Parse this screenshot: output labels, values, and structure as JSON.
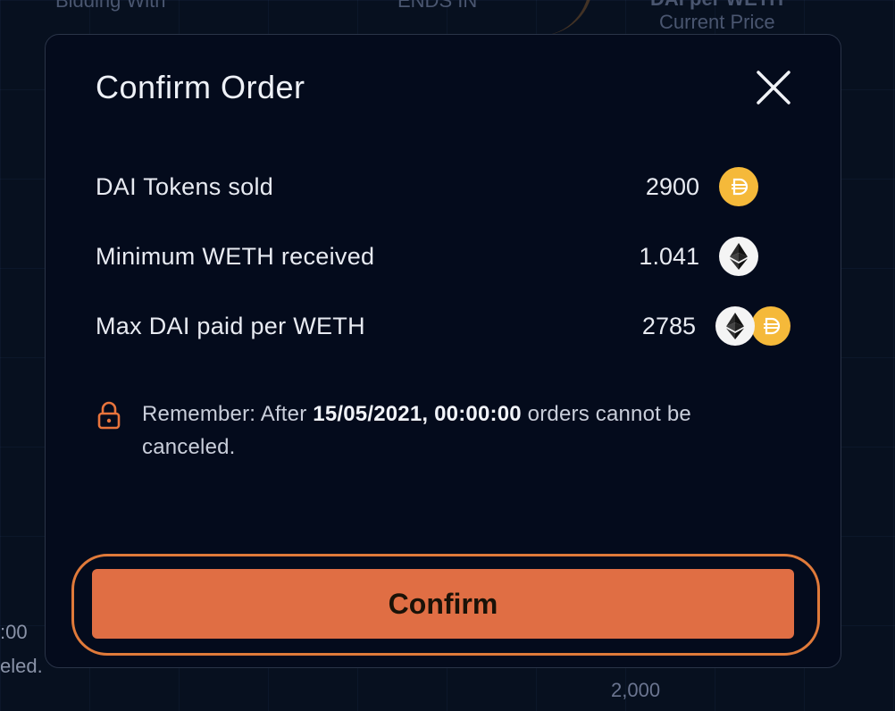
{
  "background": {
    "bidding_with": "Bidding With",
    "ends_in": "ENDS IN",
    "price_label": "Current Price",
    "price_top": "DAI per WETH",
    "side_time": ":00",
    "side_text": "eled.",
    "axis_tick": "2,000"
  },
  "modal": {
    "title": "Confirm Order",
    "rows": [
      {
        "label": "DAI Tokens sold",
        "value": "2900",
        "icon": "dai-token-icon"
      },
      {
        "label": "Minimum WETH received",
        "value": "1.041",
        "icon": "eth-token-icon"
      },
      {
        "label": "Max DAI paid per WETH",
        "value": "2785",
        "icon": "eth-dai-pair-icon"
      }
    ],
    "notice": {
      "prefix": "Remember: After ",
      "datetime": "15/05/2021, 00:00:00",
      "suffix": " orders cannot be canceled."
    },
    "confirm_label": "Confirm"
  },
  "colors": {
    "accent": "#e06e44",
    "dai": "#f5b93a",
    "lock": "#e8743c"
  }
}
